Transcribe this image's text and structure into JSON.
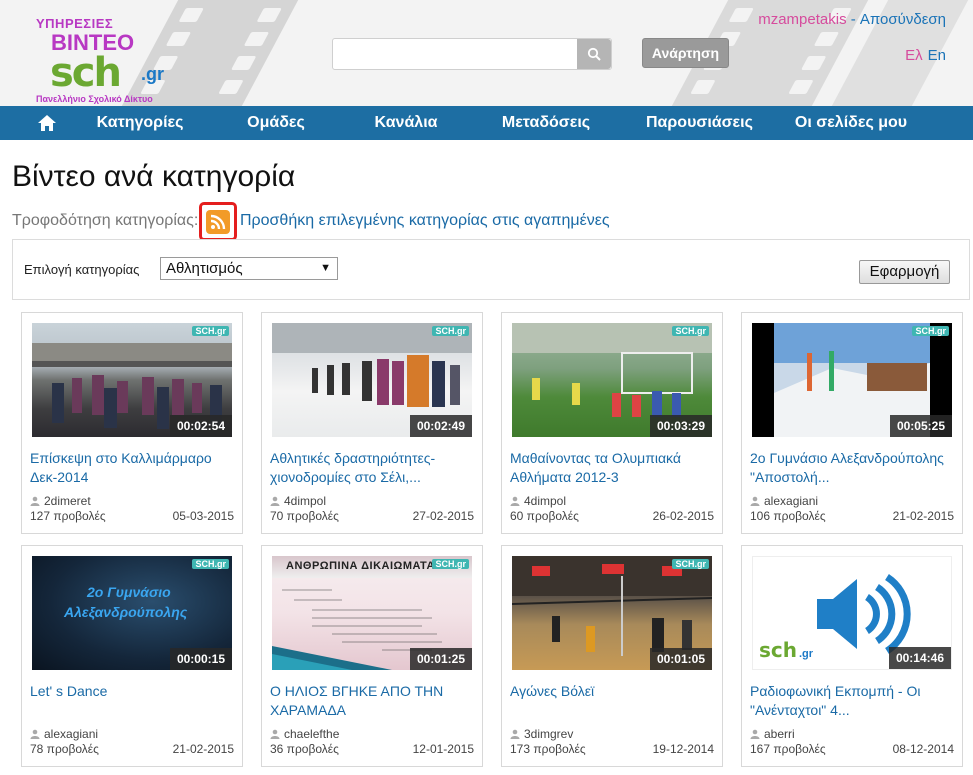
{
  "header": {
    "logo": {
      "line1": "ΥΠΗΡΕΣΙΕΣ",
      "line2": "ΒΙΝΤΕΟ",
      "brand": "sch",
      "tld": ".gr",
      "subtitle": "Πανελλήνιο Σχολικό Δίκτυο"
    },
    "search": {
      "value": "",
      "placeholder": ""
    },
    "upload_label": "Ανάρτηση",
    "username": "mzampetakis",
    "separator": " - ",
    "logout_label": "Αποσύνδεση",
    "lang_el": "Ελ",
    "lang_en": "En"
  },
  "nav": {
    "items": [
      {
        "label": "Κατηγορίες"
      },
      {
        "label": "Ομάδες"
      },
      {
        "label": "Κανάλια"
      },
      {
        "label": "Μεταδόσεις"
      },
      {
        "label": "Παρουσιάσεις"
      },
      {
        "label": "Οι σελίδες μου"
      }
    ]
  },
  "page": {
    "title": "Βίντεο ανά κατηγορία",
    "feed_label": "Τροφοδότηση κατηγορίας:",
    "favorite_link": "Προσθήκη επιλεγμένης κατηγορίας στις αγαπημένες"
  },
  "filter": {
    "label": "Επιλογή κατηγορίας",
    "selected": "Αθλητισμός",
    "apply_label": "Εφαρμογή"
  },
  "videos": [
    {
      "title": "Επίσκεψη στο Καλλιμάρμαρο Δεκ-2014",
      "duration": "00:02:54",
      "author": "2dimeret",
      "views": "127 προβολές",
      "date": "05-03-2015",
      "badge": "SCH.gr"
    },
    {
      "title": "Αθλητικές δραστηριότητες-χιονοδρομίες στο Σέλι,...",
      "duration": "00:02:49",
      "author": "4dimpol",
      "views": "70 προβολές",
      "date": "27-02-2015",
      "badge": "SCH.gr"
    },
    {
      "title": "Μαθαίνοντας τα Ολυμπιακά Αθλήματα 2012-3",
      "duration": "00:03:29",
      "author": "4dimpol",
      "views": "60 προβολές",
      "date": "26-02-2015",
      "badge": "SCH.gr"
    },
    {
      "title": "2ο Γυμνάσιο Αλεξανδρούπολης \"Αποστολή...",
      "duration": "00:05:25",
      "author": "alexagiani",
      "views": "106 προβολές",
      "date": "21-02-2015",
      "badge": "SCH.gr"
    },
    {
      "title": "Let' s Dance",
      "duration": "00:00:15",
      "author": "alexagiani",
      "views": "78 προβολές",
      "date": "21-02-2015",
      "badge": "SCH.gr",
      "overlay1": "2ο Γυμνάσιο",
      "overlay2": "Αλεξανδρούπολης"
    },
    {
      "title": "Ο ΗΛΙΟΣ ΒΓΗΚΕ ΑΠΟ ΤΗΝ ΧΑΡΑΜΑΔΑ",
      "duration": "00:01:25",
      "author": "chaelefthe",
      "views": "36 προβολές",
      "date": "12-01-2015",
      "badge": "SCH.gr",
      "overlay1": "ΑΝΘΡΩΠΙΝΑ ΔΙΚΑΙΩΜΑΤΑ"
    },
    {
      "title": "Αγώνες Βόλεϊ",
      "duration": "00:01:05",
      "author": "3dimgrev",
      "views": "173 προβολές",
      "date": "19-12-2014",
      "badge": "SCH.gr"
    },
    {
      "title": "Ραδιοφωνική Εκπομπή - Οι \"Ανένταχτοι\" 4...",
      "duration": "00:14:46",
      "author": "aberri",
      "views": "167 προβολές",
      "date": "08-12-2014",
      "badge": ""
    }
  ],
  "colors": {
    "nav": "#1d6ea3",
    "link": "#1a6aa6",
    "accent_pink": "#d64c9d",
    "rss": "#f29b28"
  }
}
